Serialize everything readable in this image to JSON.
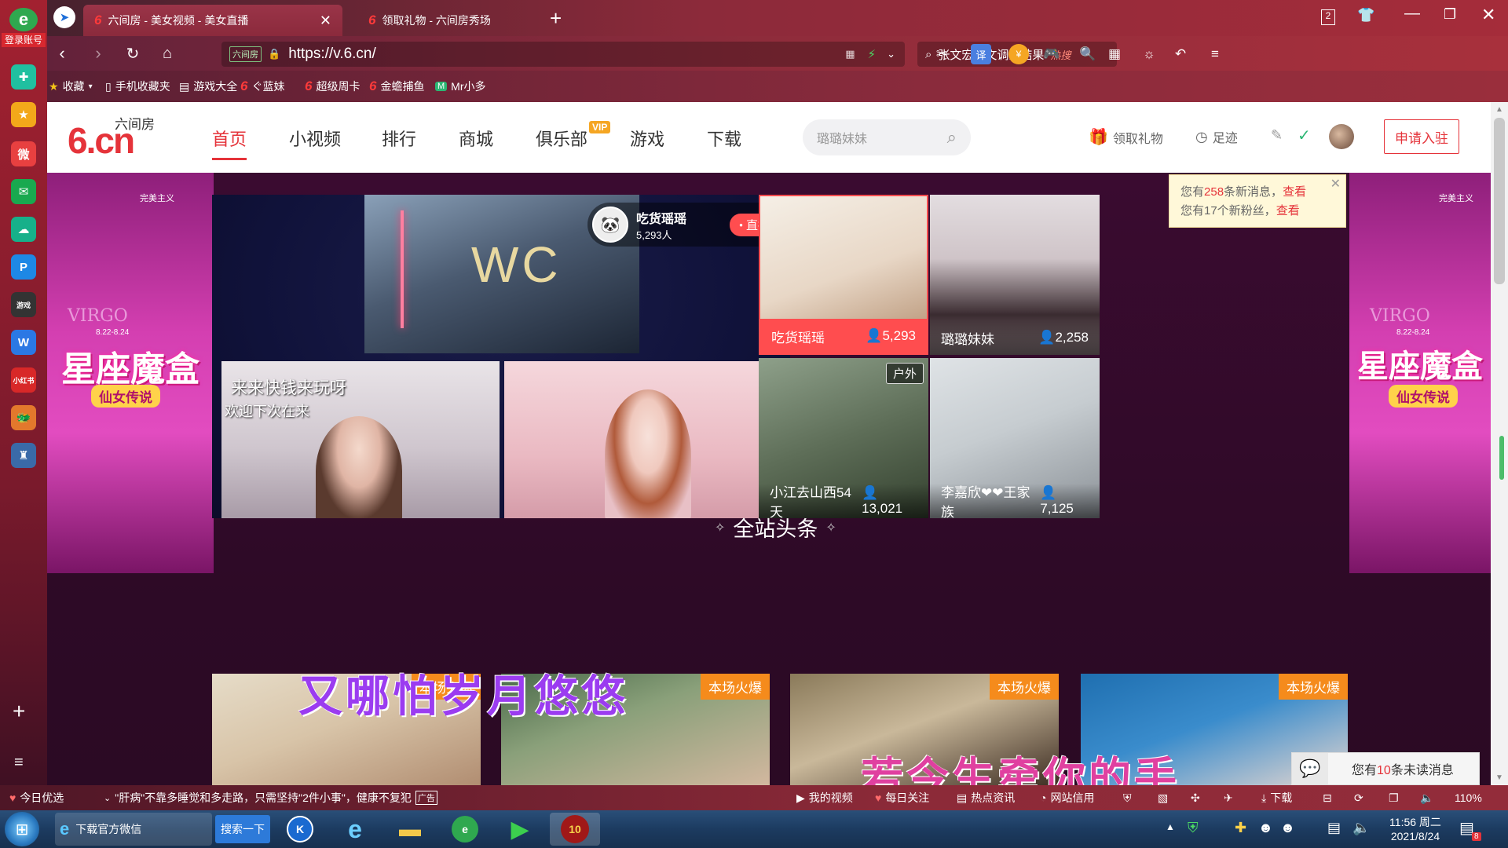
{
  "browser": {
    "login_label": "登录账号",
    "tabs": [
      {
        "title": "六间房 - 美女视频 - 美女直播"
      },
      {
        "title": "领取礼物 - 六间房秀场"
      }
    ],
    "tab_counter": "2",
    "url": "https://v.6.cn/",
    "url_badge": "六间房",
    "search_text": "张文宏论文调查结果",
    "search_badge": "热搜",
    "bookmarks": [
      "收藏",
      "手机收藏夹",
      "游戏大全",
      "ぐ蓝妹",
      "超级周卡",
      "金蟾捕鱼",
      "Mr小多"
    ]
  },
  "site": {
    "logo_big": "6.cn",
    "logo_small": "六间房",
    "nav": [
      "首页",
      "小视频",
      "排行",
      "商城",
      "俱乐部",
      "游戏",
      "下载"
    ],
    "vip_badge": "VIP",
    "search_placeholder": "璐璐妹妹",
    "gift_label": "领取礼物",
    "footprint_label": "足迹",
    "apply_label": "申请入驻"
  },
  "notification": {
    "line1_prefix": "您有",
    "line1_count": "258",
    "line1_suffix": "条新消息，",
    "line1_link": "查看",
    "line2_text": "您有17个新粉丝，",
    "line2_link": "查看"
  },
  "feature": {
    "wc_text": "WC",
    "anchor_name": "吃货瑶瑶",
    "anchor_viewers": "5,293人",
    "live_label": "直播",
    "overlay_line1": "来来快钱来玩呀",
    "overlay_line2": "欢迎下次在来"
  },
  "ads": {
    "brand": "完美主义",
    "sign": "VIRGO",
    "dates": "8.22-8.24",
    "title": "星座魔盒",
    "subtitle": "仙女传说"
  },
  "grid": [
    {
      "name": "吃货瑶瑶",
      "count": "5,293",
      "tag": ""
    },
    {
      "name": "璐璐妹妹",
      "count": "2,258",
      "tag": ""
    },
    {
      "name": "小江去山西54天",
      "count": "13,021",
      "tag": "户外"
    },
    {
      "name": "李嘉欣❤❤王家族",
      "count": "7,125",
      "tag": ""
    }
  ],
  "headline": {
    "title": "全站头条",
    "hot_label": "本场火爆",
    "lyric1": "又哪怕岁月悠悠",
    "lyric2": "若今生牵你的手"
  },
  "chat": {
    "prefix": "您有",
    "count": "10",
    "suffix": "条未读消息"
  },
  "status": {
    "today": "今日优选",
    "ticker": "\"肝病\"不靠多睡觉和多走路，只需坚持\"2件小事\"，健康不复犯",
    "ad_mark": "广告",
    "my_video": "我的视频",
    "daily": "每日关注",
    "news": "热点资讯",
    "net": "网站信用",
    "download": "下载",
    "zoom": "110%"
  },
  "taskbar": {
    "app1_label": "下载官方微信",
    "app2_label": "搜索一下",
    "time": "11:56 周二",
    "date": "2021/8/24",
    "badge": "8"
  },
  "colors": {
    "accent": "#e5333a",
    "hot": "#f58b1c",
    "live": "#ff4d4f"
  }
}
